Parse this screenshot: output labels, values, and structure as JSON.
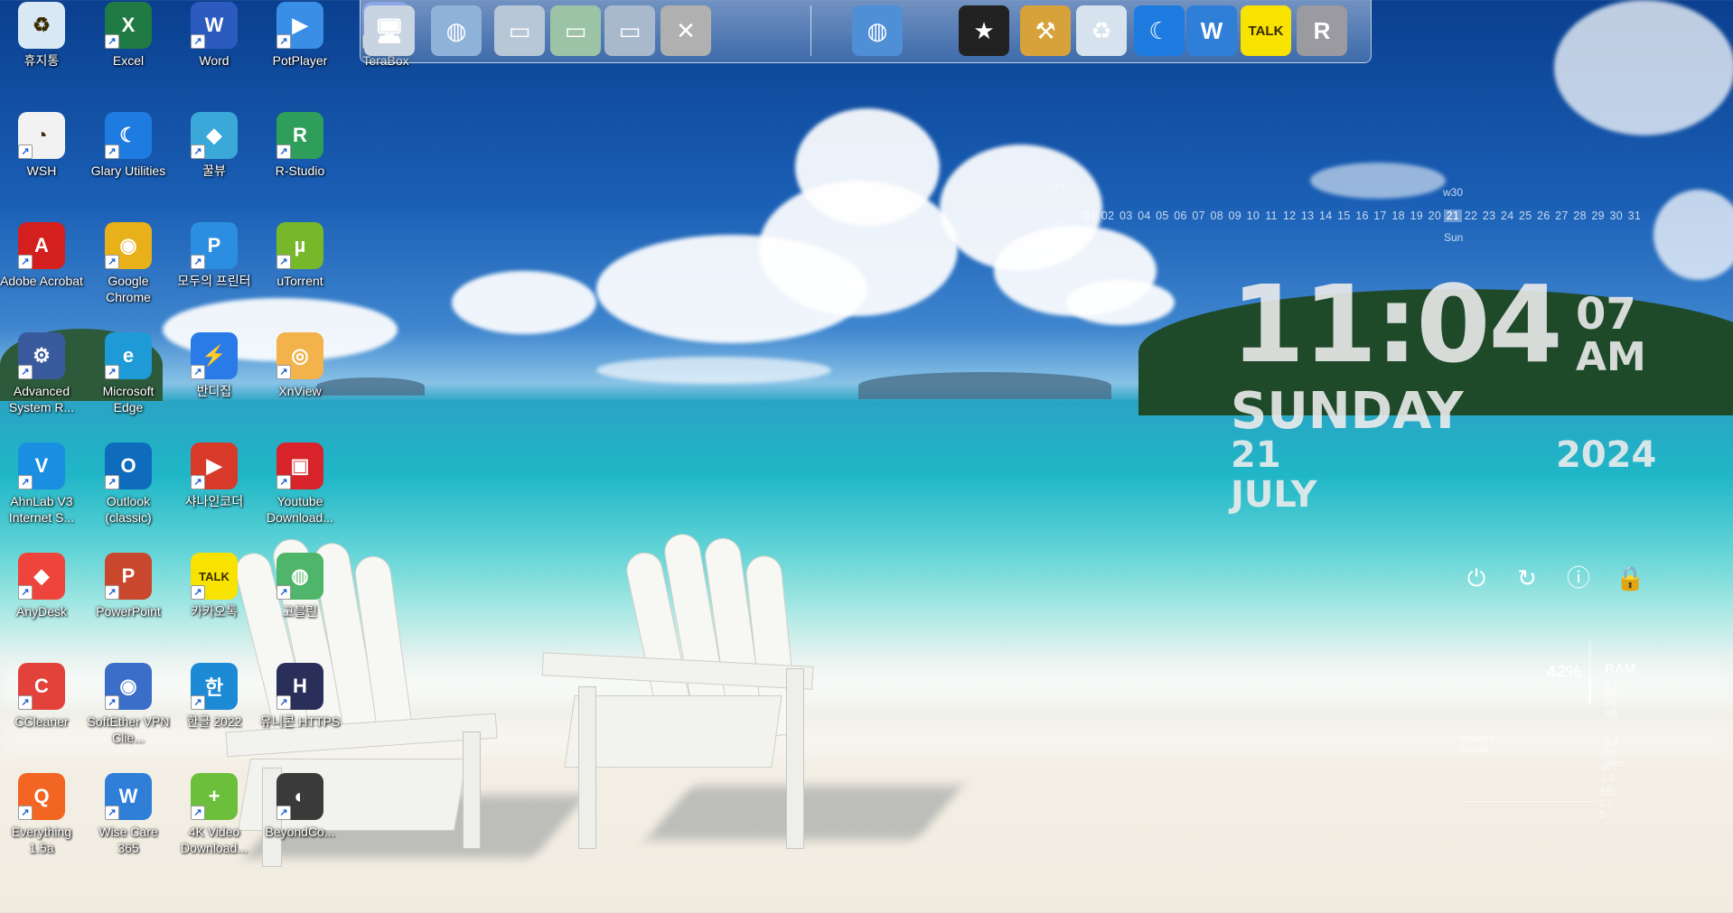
{
  "desktop": {
    "icons": [
      {
        "id": "recycle-bin",
        "label": "휴지통",
        "color": "#d8e8f5",
        "text": "♻"
      },
      {
        "id": "excel",
        "label": "Excel",
        "color": "#1f7a43",
        "text": "X"
      },
      {
        "id": "word",
        "label": "Word",
        "color": "#2b5bbf",
        "text": "W"
      },
      {
        "id": "potplayer",
        "label": "PotPlayer",
        "color": "#3a8ee6",
        "text": "▶"
      },
      {
        "id": "terabox",
        "label": "TeraBox",
        "color": "#4a6fe0",
        "text": "T"
      },
      {
        "id": "wsh",
        "label": "WSH",
        "color": "#f2f2f2",
        "text": "◔"
      },
      {
        "id": "glary-utilities",
        "label": "Glary Utilities",
        "color": "#1e7be0",
        "text": "☾"
      },
      {
        "id": "kkulbyu",
        "label": "꿀뷰",
        "color": "#3aa8d8",
        "text": "◆"
      },
      {
        "id": "r-studio",
        "label": "R-Studio",
        "color": "#2e9e5a",
        "text": "R"
      },
      {
        "id": "adobe-acrobat",
        "label": "Adobe Acrobat",
        "color": "#d3201f",
        "text": "A"
      },
      {
        "id": "google-chrome",
        "label": "Google Chrome",
        "color": "#e8b019",
        "text": "◉"
      },
      {
        "id": "modu-printer",
        "label": "모두의 프린터",
        "color": "#2b8ee0",
        "text": "P"
      },
      {
        "id": "utorrent",
        "label": "uTorrent",
        "color": "#76b82a",
        "text": "µ"
      },
      {
        "id": "advanced-system-repair",
        "label": "Advanced System R...",
        "color": "#3a5a9e",
        "text": "⚙"
      },
      {
        "id": "microsoft-edge",
        "label": "Microsoft Edge",
        "color": "#1e9ad6",
        "text": "e"
      },
      {
        "id": "bandizip",
        "label": "반디집",
        "color": "#2a7be8",
        "text": "⚡"
      },
      {
        "id": "xnview",
        "label": "XnView",
        "color": "#f3b24a",
        "text": "◎"
      },
      {
        "id": "ahnlab-v3",
        "label": "AhnLab V3 Internet S...",
        "color": "#1a8ee0",
        "text": "V"
      },
      {
        "id": "outlook-classic",
        "label": "Outlook (classic)",
        "color": "#0f6cbd",
        "text": "O"
      },
      {
        "id": "shana-encoder",
        "label": "샤나인코더",
        "color": "#d83a2a",
        "text": "▶"
      },
      {
        "id": "youtube-downloader",
        "label": "Youtube Download...",
        "color": "#d8232a",
        "text": "▣"
      },
      {
        "id": "anydesk",
        "label": "AnyDesk",
        "color": "#ef443b",
        "text": "◆"
      },
      {
        "id": "powerpoint",
        "label": "PowerPoint",
        "color": "#c8472d",
        "text": "P"
      },
      {
        "id": "kakaotalk",
        "label": "카카오톡",
        "color": "#f7e200",
        "text": "TALK"
      },
      {
        "id": "gobulrin",
        "label": "고블린",
        "color": "#4fb56a",
        "text": "◍"
      },
      {
        "id": "ccleaner",
        "label": "CCleaner",
        "color": "#e2423a",
        "text": "C"
      },
      {
        "id": "softether-vpn",
        "label": "SoftEther VPN Clie...",
        "color": "#3a6ec8",
        "text": "◉"
      },
      {
        "id": "hangul-2022",
        "label": "한글 2022",
        "color": "#1d8ad6",
        "text": "한"
      },
      {
        "id": "unicorn-https",
        "label": "유니콘 HTTPS",
        "color": "#2a2f5a",
        "text": "H"
      },
      {
        "id": "everything",
        "label": "Everything 1.5a",
        "color": "#f26522",
        "text": "Q"
      },
      {
        "id": "wise-care-365",
        "label": "Wise Care 365",
        "color": "#2f7ed8",
        "text": "W"
      },
      {
        "id": "4k-video-downloader",
        "label": "4K Video Download...",
        "color": "#6cbf3a",
        "text": "+"
      },
      {
        "id": "beyond-compare",
        "label": "BeyondCo...",
        "color": "#3a3a3a",
        "text": "◐"
      }
    ]
  },
  "dock": {
    "items": [
      {
        "id": "dock-computer",
        "color": "#c9d4e2",
        "text": "🖥"
      },
      {
        "id": "dock-network",
        "color": "#8fb2d8",
        "text": "◍"
      },
      {
        "id": "dock-folder-docs",
        "color": "#b8c7d6",
        "text": "▭"
      },
      {
        "id": "dock-folder-downloads",
        "color": "#9dc3a6",
        "text": "▭"
      },
      {
        "id": "dock-folder-pictures",
        "color": "#a9b9cc",
        "text": "▭"
      },
      {
        "id": "dock-tools",
        "color": "#b0b0b0",
        "text": "✕"
      },
      {
        "id": "dock-globe",
        "color": "#4f8fd6",
        "text": "◍"
      },
      {
        "id": "dock-tshirt",
        "color": "#222222",
        "text": "★"
      },
      {
        "id": "dock-hammer",
        "color": "#d8a23a",
        "text": "⚒"
      },
      {
        "id": "dock-recycle",
        "color": "#d6e3ee",
        "text": "♻"
      },
      {
        "id": "dock-glary",
        "color": "#1e7be0",
        "text": "☾"
      },
      {
        "id": "dock-wise",
        "color": "#2f7ed8",
        "text": "W"
      },
      {
        "id": "dock-kakaotalk",
        "color": "#f7e200",
        "text": "TALK"
      },
      {
        "id": "dock-r-studio",
        "color": "#9a9aa0",
        "text": "R"
      }
    ]
  },
  "calendar": {
    "year": "2024",
    "month": "07",
    "week": "w30",
    "days": [
      "01",
      "02",
      "03",
      "04",
      "05",
      "06",
      "07",
      "08",
      "09",
      "10",
      "11",
      "12",
      "13",
      "14",
      "15",
      "16",
      "17",
      "18",
      "19",
      "20",
      "21",
      "22",
      "23",
      "24",
      "25",
      "26",
      "27",
      "28",
      "29",
      "30",
      "31"
    ],
    "today": "21",
    "today_dow": "Sun"
  },
  "clock": {
    "time": "11:04",
    "seconds": "07",
    "ampm": "AM",
    "day": "SUNDAY",
    "date": "21 JULY",
    "year": "2024"
  },
  "power": {
    "buttons": [
      {
        "id": "shutdown-icon",
        "glyph": "⏻"
      },
      {
        "id": "restart-icon",
        "glyph": "↻"
      },
      {
        "id": "logoff-icon",
        "glyph": "ⓘ"
      },
      {
        "id": "lock-icon",
        "glyph": "🔒"
      }
    ]
  },
  "ram": {
    "percent": "42%",
    "percent_value": 42,
    "label": "RAM",
    "used": "3.3 GB",
    "total": "of 7.8 GB"
  },
  "network": {
    "title": "Network Activity",
    "uptime": "0 d 0h 06m",
    "in": "In: 1.3 kB",
    "out": "Out: 0.0 B"
  }
}
